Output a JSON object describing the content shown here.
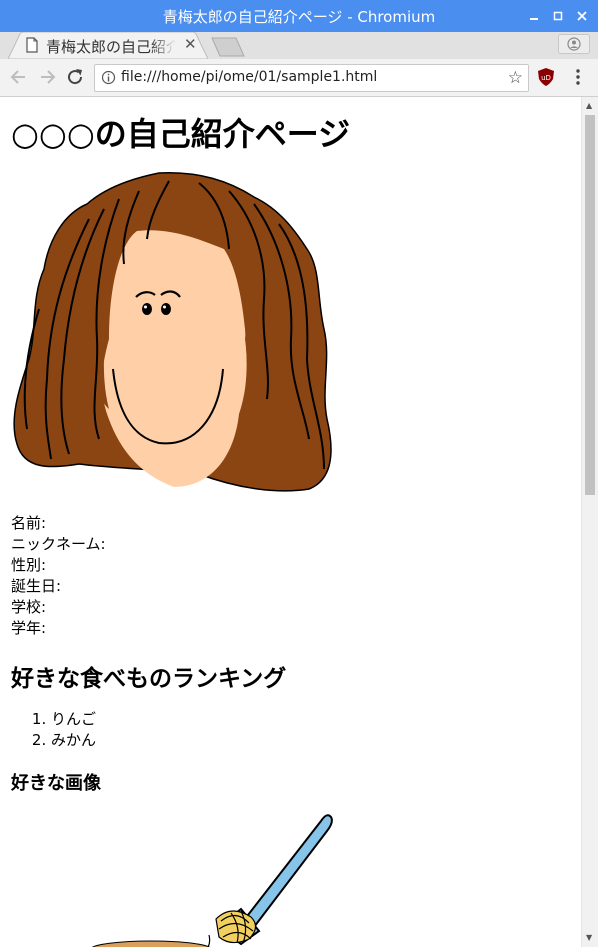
{
  "window": {
    "title": "青梅太郎の自己紹介ページ - Chromium",
    "controls": {
      "minimize": "▁",
      "maximize": "□",
      "close": "✕"
    }
  },
  "tab": {
    "title": "青梅太郎の自己紹介ページ",
    "close": "✕"
  },
  "toolbar": {
    "url": "file:///home/pi/ome/01/sample1.html",
    "star": "☆"
  },
  "page": {
    "title": "○○○の自己紹介ページ",
    "profile_fields": [
      "名前:",
      "ニックネーム:",
      "性別:",
      "誕生日:",
      "学校:",
      "学年:"
    ],
    "ranking_heading": "好きな食べものランキング",
    "ranking_items": [
      "りんご",
      "みかん"
    ],
    "image_heading": "好きな画像"
  },
  "colors": {
    "titlebar": "#4a8ef0",
    "hair": "#8b4513",
    "skin": "#ffd0a8",
    "fork": "#87c4ea",
    "noodles": "#f2d060"
  }
}
